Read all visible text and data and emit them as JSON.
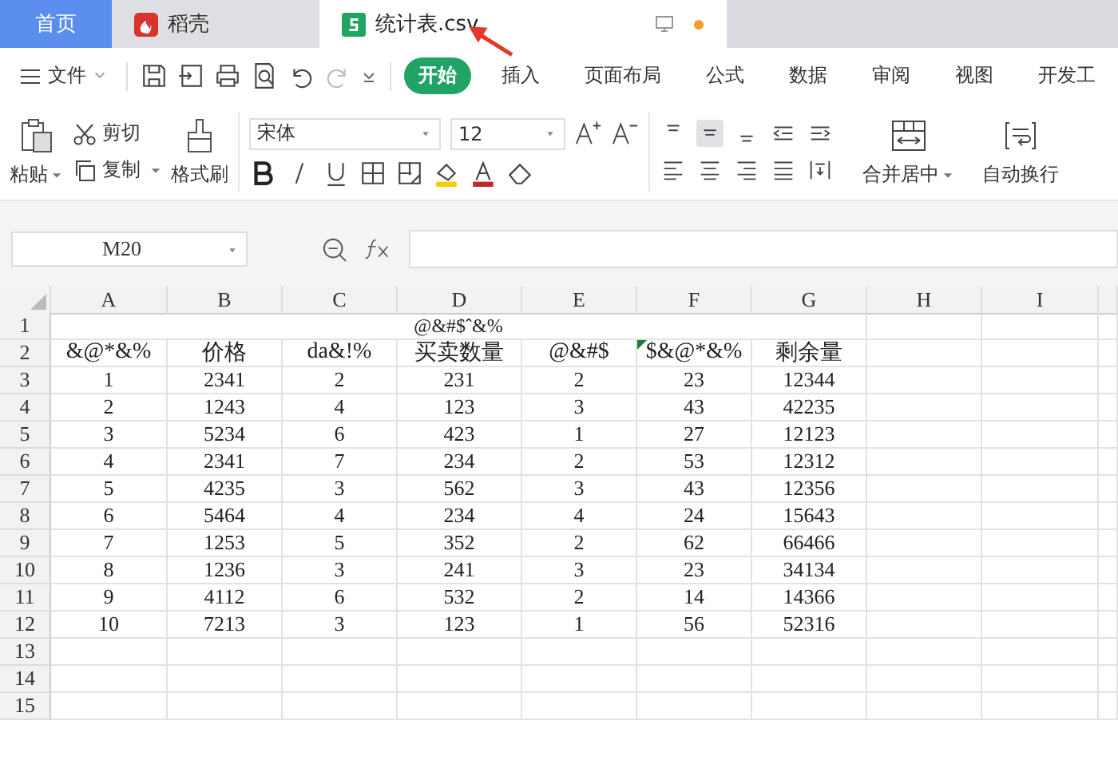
{
  "tabs": [
    {
      "label": "首页",
      "kind": "home",
      "selected": false
    },
    {
      "label": "稻壳",
      "kind": "docer",
      "selected": false
    },
    {
      "label": "统计表.csv",
      "kind": "sheet",
      "selected": true
    }
  ],
  "menu": {
    "file": "文件",
    "ribbon_tabs": [
      {
        "label": "开始",
        "selected": true
      },
      {
        "label": "插入",
        "selected": false
      },
      {
        "label": "页面布局",
        "selected": false
      },
      {
        "label": "公式",
        "selected": false
      },
      {
        "label": "数据",
        "selected": false
      },
      {
        "label": "审阅",
        "selected": false
      },
      {
        "label": "视图",
        "selected": false
      },
      {
        "label": "开发工",
        "selected": false
      }
    ]
  },
  "ribbon": {
    "paste": "粘贴",
    "cut": "剪切",
    "copy": "复制",
    "format_painter": "格式刷",
    "font_name": "宋体",
    "font_size": "12",
    "alignment": [
      {
        "selected": false
      },
      {
        "selected": true
      },
      {
        "selected": false
      },
      {
        "selected": false
      },
      {
        "selected": false
      }
    ],
    "merge": "合并居中",
    "wrap": "自动换行"
  },
  "name_box": "M20",
  "columns": [
    "A",
    "B",
    "C",
    "D",
    "E",
    "F",
    "G",
    "H",
    "I"
  ],
  "title": "@&#$ˆ&%",
  "header_row": [
    {
      "text": "&@*&%",
      "flagged": false
    },
    {
      "text": "价格",
      "flagged": false
    },
    {
      "text": "da&!%",
      "flagged": false
    },
    {
      "text": "买卖数量",
      "flagged": false
    },
    {
      "text": "@&#$",
      "flagged": false
    },
    {
      "text": "$&@*&%",
      "flagged": true
    },
    {
      "text": "剩余量",
      "flagged": false
    }
  ],
  "rows": [
    [
      "1",
      "2341",
      "2",
      "231",
      "2",
      "23",
      "12344"
    ],
    [
      "2",
      "1243",
      "4",
      "123",
      "3",
      "43",
      "42235"
    ],
    [
      "3",
      "5234",
      "6",
      "423",
      "1",
      "27",
      "12123"
    ],
    [
      "4",
      "2341",
      "7",
      "234",
      "2",
      "53",
      "12312"
    ],
    [
      "5",
      "4235",
      "3",
      "562",
      "3",
      "43",
      "12356"
    ],
    [
      "6",
      "5464",
      "4",
      "234",
      "4",
      "24",
      "15643"
    ],
    [
      "7",
      "1253",
      "5",
      "352",
      "2",
      "62",
      "66466"
    ],
    [
      "8",
      "1236",
      "3",
      "241",
      "3",
      "23",
      "34134"
    ],
    [
      "9",
      "4112",
      "6",
      "532",
      "2",
      "14",
      "14366"
    ],
    [
      "10",
      "7213",
      "3",
      "123",
      "1",
      "56",
      "52316"
    ]
  ],
  "row_numbers": [
    "1",
    "2",
    "3",
    "4",
    "5",
    "6",
    "7",
    "8",
    "9",
    "10",
    "11",
    "12",
    "13",
    "14",
    "15"
  ]
}
